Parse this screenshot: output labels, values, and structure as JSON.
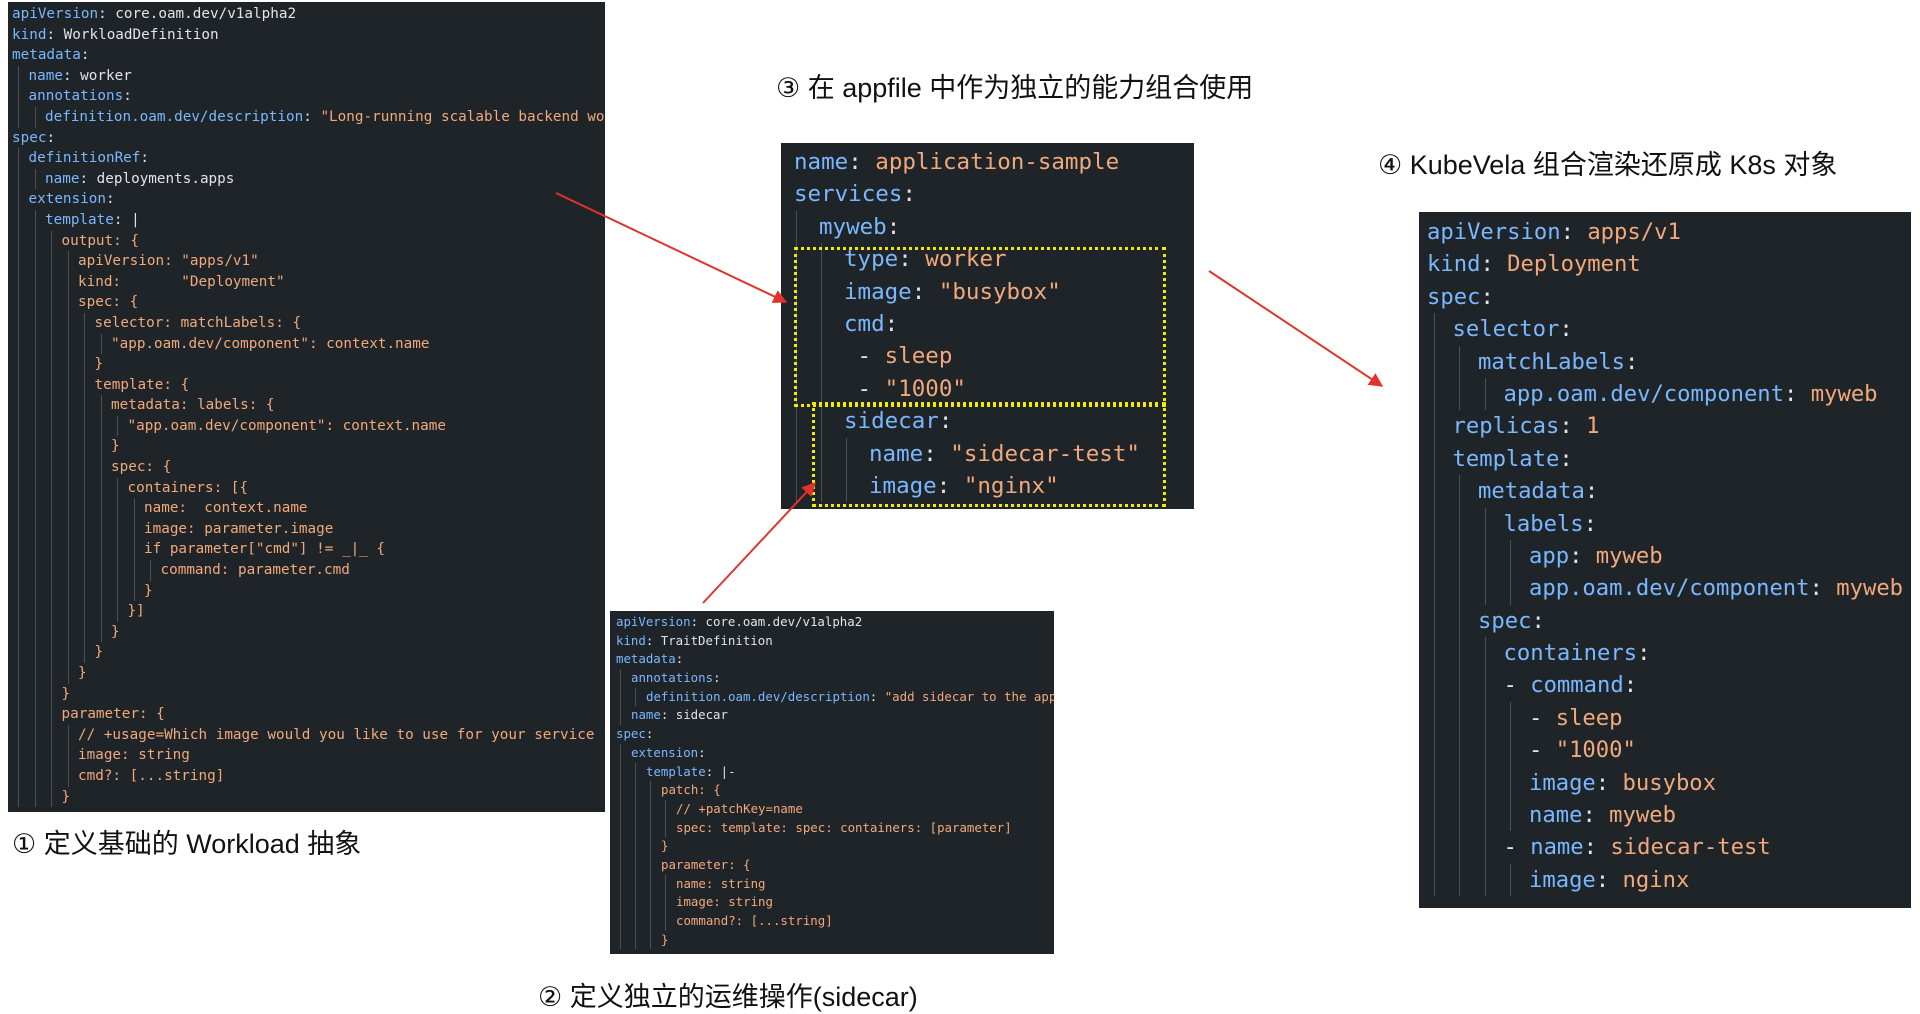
{
  "captions": {
    "workload": "① 定义基础的 Workload 抽象",
    "sidecar": "② 定义独立的运维操作(sidecar)",
    "appfile": "③ 在 appfile 中作为独立的能力组合使用",
    "render": "④ KubeVela 组合渲染还原成 K8s 对象"
  },
  "colors": {
    "panel_background": "#1f2428",
    "key": "#79b8ff",
    "value": "#e1e4e8",
    "string": "#f1a97c",
    "arrow": "#e0342b",
    "highlight_box": "#f2ea00"
  },
  "workload_definition": {
    "lines": [
      {
        "indent": 0,
        "parts": [
          [
            "k",
            "apiVersion"
          ],
          [
            "v",
            ": core.oam.dev/v1alpha2"
          ]
        ]
      },
      {
        "indent": 0,
        "parts": [
          [
            "k",
            "kind"
          ],
          [
            "v",
            ": WorkloadDefinition"
          ]
        ]
      },
      {
        "indent": 0,
        "parts": [
          [
            "k",
            "metadata"
          ],
          [
            "v",
            ":"
          ]
        ]
      },
      {
        "indent": 1,
        "parts": [
          [
            "k",
            "name"
          ],
          [
            "v",
            ": worker"
          ]
        ]
      },
      {
        "indent": 1,
        "parts": [
          [
            "k",
            "annotations"
          ],
          [
            "v",
            ":"
          ]
        ]
      },
      {
        "indent": 2,
        "parts": [
          [
            "k",
            "definition.oam.dev/description"
          ],
          [
            "v",
            ": "
          ],
          [
            "s",
            "\"Long-running scalable backend worker\""
          ]
        ]
      },
      {
        "indent": 0,
        "parts": [
          [
            "k",
            "spec"
          ],
          [
            "v",
            ":"
          ]
        ]
      },
      {
        "indent": 1,
        "parts": [
          [
            "k",
            "definitionRef"
          ],
          [
            "v",
            ":"
          ]
        ]
      },
      {
        "indent": 2,
        "parts": [
          [
            "k",
            "name"
          ],
          [
            "v",
            ": deployments.apps"
          ]
        ]
      },
      {
        "indent": 1,
        "parts": [
          [
            "k",
            "extension"
          ],
          [
            "v",
            ":"
          ]
        ]
      },
      {
        "indent": 2,
        "parts": [
          [
            "k",
            "template"
          ],
          [
            "v",
            ": |"
          ]
        ]
      },
      {
        "indent": 3,
        "parts": [
          [
            "s",
            "output: {"
          ]
        ]
      },
      {
        "indent": 4,
        "parts": [
          [
            "s",
            "apiVersion: \"apps/v1\""
          ]
        ]
      },
      {
        "indent": 4,
        "parts": [
          [
            "s",
            "kind:       \"Deployment\""
          ]
        ]
      },
      {
        "indent": 4,
        "parts": [
          [
            "s",
            "spec: {"
          ]
        ]
      },
      {
        "indent": 5,
        "parts": [
          [
            "s",
            "selector: matchLabels: {"
          ]
        ]
      },
      {
        "indent": 6,
        "parts": [
          [
            "s",
            "\"app.oam.dev/component\": context.name"
          ]
        ]
      },
      {
        "indent": 5,
        "parts": [
          [
            "s",
            "}"
          ]
        ]
      },
      {
        "indent": 5,
        "parts": [
          [
            "s",
            "template: {"
          ]
        ]
      },
      {
        "indent": 6,
        "parts": [
          [
            "s",
            "metadata: labels: {"
          ]
        ]
      },
      {
        "indent": 7,
        "parts": [
          [
            "s",
            "\"app.oam.dev/component\": context.name"
          ]
        ]
      },
      {
        "indent": 6,
        "parts": [
          [
            "s",
            "}"
          ]
        ]
      },
      {
        "indent": 6,
        "parts": [
          [
            "s",
            "spec: {"
          ]
        ]
      },
      {
        "indent": 7,
        "parts": [
          [
            "s",
            "containers: [{"
          ]
        ]
      },
      {
        "indent": 8,
        "parts": [
          [
            "s",
            "name:  context.name"
          ]
        ]
      },
      {
        "indent": 8,
        "parts": [
          [
            "s",
            "image: parameter.image"
          ]
        ]
      },
      {
        "indent": 8,
        "parts": [
          [
            "s",
            "if parameter[\"cmd\"] != _|_ {"
          ]
        ]
      },
      {
        "indent": 9,
        "parts": [
          [
            "s",
            "command: parameter.cmd"
          ]
        ]
      },
      {
        "indent": 8,
        "parts": [
          [
            "s",
            "}"
          ]
        ]
      },
      {
        "indent": 7,
        "parts": [
          [
            "s",
            "}]"
          ]
        ]
      },
      {
        "indent": 6,
        "parts": [
          [
            "s",
            "}"
          ]
        ]
      },
      {
        "indent": 5,
        "parts": [
          [
            "s",
            "}"
          ]
        ]
      },
      {
        "indent": 4,
        "parts": [
          [
            "s",
            "}"
          ]
        ]
      },
      {
        "indent": 3,
        "parts": [
          [
            "s",
            "}"
          ]
        ]
      },
      {
        "indent": 3,
        "parts": [
          [
            "s",
            "parameter: {"
          ]
        ]
      },
      {
        "indent": 4,
        "parts": [
          [
            "s",
            "// +usage=Which image would you like to use for your service"
          ]
        ]
      },
      {
        "indent": 4,
        "parts": [
          [
            "s",
            "image: string"
          ]
        ]
      },
      {
        "indent": 4,
        "parts": [
          [
            "s",
            "cmd?: [...string]"
          ]
        ]
      },
      {
        "indent": 3,
        "parts": [
          [
            "s",
            "}"
          ]
        ]
      }
    ]
  },
  "trait_definition": {
    "lines": [
      {
        "indent": 0,
        "parts": [
          [
            "k",
            "apiVersion"
          ],
          [
            "v",
            ": core.oam.dev/v1alpha2"
          ]
        ]
      },
      {
        "indent": 0,
        "parts": [
          [
            "k",
            "kind"
          ],
          [
            "v",
            ": TraitDefinition"
          ]
        ]
      },
      {
        "indent": 0,
        "parts": [
          [
            "k",
            "metadata"
          ],
          [
            "v",
            ":"
          ]
        ]
      },
      {
        "indent": 1,
        "parts": [
          [
            "k",
            "annotations"
          ],
          [
            "v",
            ":"
          ]
        ]
      },
      {
        "indent": 2,
        "parts": [
          [
            "k",
            "definition.oam.dev/description"
          ],
          [
            "v",
            ": "
          ],
          [
            "s",
            "\"add sidecar to the app\""
          ]
        ]
      },
      {
        "indent": 1,
        "parts": [
          [
            "k",
            "name"
          ],
          [
            "v",
            ": sidecar"
          ]
        ]
      },
      {
        "indent": 0,
        "parts": [
          [
            "k",
            "spec"
          ],
          [
            "v",
            ":"
          ]
        ]
      },
      {
        "indent": 1,
        "parts": [
          [
            "k",
            "extension"
          ],
          [
            "v",
            ":"
          ]
        ]
      },
      {
        "indent": 2,
        "parts": [
          [
            "k",
            "template"
          ],
          [
            "v",
            ": |-"
          ]
        ]
      },
      {
        "indent": 3,
        "parts": [
          [
            "s",
            "patch: {"
          ]
        ]
      },
      {
        "indent": 4,
        "parts": [
          [
            "s",
            "// +patchKey=name"
          ]
        ]
      },
      {
        "indent": 4,
        "parts": [
          [
            "s",
            "spec: template: spec: containers: [parameter]"
          ]
        ]
      },
      {
        "indent": 3,
        "parts": [
          [
            "s",
            "}"
          ]
        ]
      },
      {
        "indent": 3,
        "parts": [
          [
            "s",
            "parameter: {"
          ]
        ]
      },
      {
        "indent": 4,
        "parts": [
          [
            "s",
            "name: string"
          ]
        ]
      },
      {
        "indent": 4,
        "parts": [
          [
            "s",
            "image: string"
          ]
        ]
      },
      {
        "indent": 4,
        "parts": [
          [
            "s",
            "command?: [...string]"
          ]
        ]
      },
      {
        "indent": 3,
        "parts": [
          [
            "s",
            "}"
          ]
        ]
      }
    ]
  },
  "appfile": {
    "lines": [
      {
        "indent": 0,
        "parts": [
          [
            "k",
            "name"
          ],
          [
            "v",
            ": "
          ],
          [
            "s",
            "application-sample"
          ]
        ]
      },
      {
        "indent": 0,
        "parts": [
          [
            "k",
            "services"
          ],
          [
            "v",
            ":"
          ]
        ]
      },
      {
        "indent": 1,
        "parts": [
          [
            "k",
            "myweb"
          ],
          [
            "v",
            ":"
          ]
        ]
      },
      {
        "indent": 2,
        "parts": [
          [
            "k",
            "type"
          ],
          [
            "v",
            ": "
          ],
          [
            "s",
            "worker"
          ]
        ]
      },
      {
        "indent": 2,
        "parts": [
          [
            "k",
            "image"
          ],
          [
            "v",
            ": "
          ],
          [
            "s",
            "\"busybox\""
          ]
        ]
      },
      {
        "indent": 2,
        "parts": [
          [
            "k",
            "cmd"
          ],
          [
            "v",
            ":"
          ]
        ]
      },
      {
        "indent": 2,
        "parts": [
          [
            "v",
            " - "
          ],
          [
            "s",
            "sleep"
          ]
        ]
      },
      {
        "indent": 2,
        "parts": [
          [
            "v",
            " - "
          ],
          [
            "s",
            "\"1000\""
          ]
        ]
      },
      {
        "indent": 2,
        "parts": [
          [
            "k",
            "sidecar"
          ],
          [
            "v",
            ":"
          ]
        ]
      },
      {
        "indent": 3,
        "parts": [
          [
            "k",
            "name"
          ],
          [
            "v",
            ": "
          ],
          [
            "s",
            "\"sidecar-test\""
          ]
        ]
      },
      {
        "indent": 3,
        "parts": [
          [
            "k",
            "image"
          ],
          [
            "v",
            ": "
          ],
          [
            "s",
            "\"nginx\""
          ]
        ]
      }
    ]
  },
  "k8s_object": {
    "lines": [
      {
        "indent": 0,
        "parts": [
          [
            "k",
            "apiVersion"
          ],
          [
            "v",
            ": "
          ],
          [
            "s",
            "apps/v1"
          ]
        ]
      },
      {
        "indent": 0,
        "parts": [
          [
            "k",
            "kind"
          ],
          [
            "v",
            ": "
          ],
          [
            "s",
            "Deployment"
          ]
        ]
      },
      {
        "indent": 0,
        "parts": [
          [
            "k",
            "spec"
          ],
          [
            "v",
            ":"
          ]
        ]
      },
      {
        "indent": 1,
        "parts": [
          [
            "k",
            "selector"
          ],
          [
            "v",
            ":"
          ]
        ]
      },
      {
        "indent": 2,
        "parts": [
          [
            "k",
            "matchLabels"
          ],
          [
            "v",
            ":"
          ]
        ]
      },
      {
        "indent": 3,
        "parts": [
          [
            "k",
            "app.oam.dev/component"
          ],
          [
            "v",
            ": "
          ],
          [
            "s",
            "myweb"
          ]
        ]
      },
      {
        "indent": 1,
        "parts": [
          [
            "k",
            "replicas"
          ],
          [
            "v",
            ": "
          ],
          [
            "s",
            "1"
          ]
        ]
      },
      {
        "indent": 1,
        "parts": [
          [
            "k",
            "template"
          ],
          [
            "v",
            ":"
          ]
        ]
      },
      {
        "indent": 2,
        "parts": [
          [
            "k",
            "metadata"
          ],
          [
            "v",
            ":"
          ]
        ]
      },
      {
        "indent": 3,
        "parts": [
          [
            "k",
            "labels"
          ],
          [
            "v",
            ":"
          ]
        ]
      },
      {
        "indent": 4,
        "parts": [
          [
            "k",
            "app"
          ],
          [
            "v",
            ": "
          ],
          [
            "s",
            "myweb"
          ]
        ]
      },
      {
        "indent": 4,
        "parts": [
          [
            "k",
            "app.oam.dev/component"
          ],
          [
            "v",
            ": "
          ],
          [
            "s",
            "myweb"
          ]
        ]
      },
      {
        "indent": 2,
        "parts": [
          [
            "k",
            "spec"
          ],
          [
            "v",
            ":"
          ]
        ]
      },
      {
        "indent": 3,
        "parts": [
          [
            "k",
            "containers"
          ],
          [
            "v",
            ":"
          ]
        ]
      },
      {
        "indent": 3,
        "parts": [
          [
            "v",
            "- "
          ],
          [
            "k",
            "command"
          ],
          [
            "v",
            ":"
          ]
        ]
      },
      {
        "indent": 4,
        "parts": [
          [
            "v",
            "- "
          ],
          [
            "s",
            "sleep"
          ]
        ]
      },
      {
        "indent": 4,
        "parts": [
          [
            "v",
            "- "
          ],
          [
            "s",
            "\"1000\""
          ]
        ]
      },
      {
        "indent": 4,
        "parts": [
          [
            "k",
            "image"
          ],
          [
            "v",
            ": "
          ],
          [
            "s",
            "busybox"
          ]
        ]
      },
      {
        "indent": 4,
        "parts": [
          [
            "k",
            "name"
          ],
          [
            "v",
            ": "
          ],
          [
            "s",
            "myweb"
          ]
        ]
      },
      {
        "indent": 3,
        "parts": [
          [
            "v",
            "- "
          ],
          [
            "k",
            "name"
          ],
          [
            "v",
            ": "
          ],
          [
            "s",
            "sidecar-test"
          ]
        ]
      },
      {
        "indent": 4,
        "parts": [
          [
            "k",
            "image"
          ],
          [
            "v",
            ": "
          ],
          [
            "s",
            "nginx"
          ]
        ]
      }
    ]
  }
}
